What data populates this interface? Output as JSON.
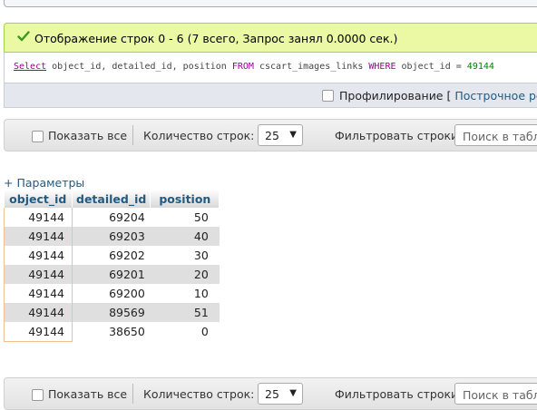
{
  "success": {
    "message": "Отображение строк 0 - 6 (7 всего, Запрос занял 0.0000 сек.)"
  },
  "sql": {
    "select_kw": "Select",
    "columns": "object_id, detailed_id, position",
    "from_kw": "FROM",
    "table": "cscart_images_links",
    "where_kw": "WHERE",
    "condition_field": "object_id =",
    "condition_value": "49144"
  },
  "profiling": {
    "label": "Профилирование [",
    "link": "Построчное реда"
  },
  "toolbar": {
    "show_all_label": "Показать все",
    "rows_count_label": "Количество строк:",
    "rows_count_value": "25",
    "filter_label": "Фильтровать строки:",
    "filter_placeholder": "Поиск в табли"
  },
  "params_link": "+ Параметры",
  "table": {
    "columns": [
      "object_id",
      "detailed_id",
      "position"
    ],
    "rows": [
      [
        "49144",
        "69204",
        "50"
      ],
      [
        "49144",
        "69203",
        "40"
      ],
      [
        "49144",
        "69202",
        "30"
      ],
      [
        "49144",
        "69201",
        "20"
      ],
      [
        "49144",
        "69200",
        "10"
      ],
      [
        "49144",
        "89569",
        "51"
      ],
      [
        "49144",
        "38650",
        "0"
      ]
    ]
  },
  "icons": {
    "success": "check-icon",
    "dropdown": "chevron-down-icon"
  },
  "colors": {
    "success_bg": "#ebf8a4",
    "link": "#235a81",
    "keyword": "#990099"
  }
}
